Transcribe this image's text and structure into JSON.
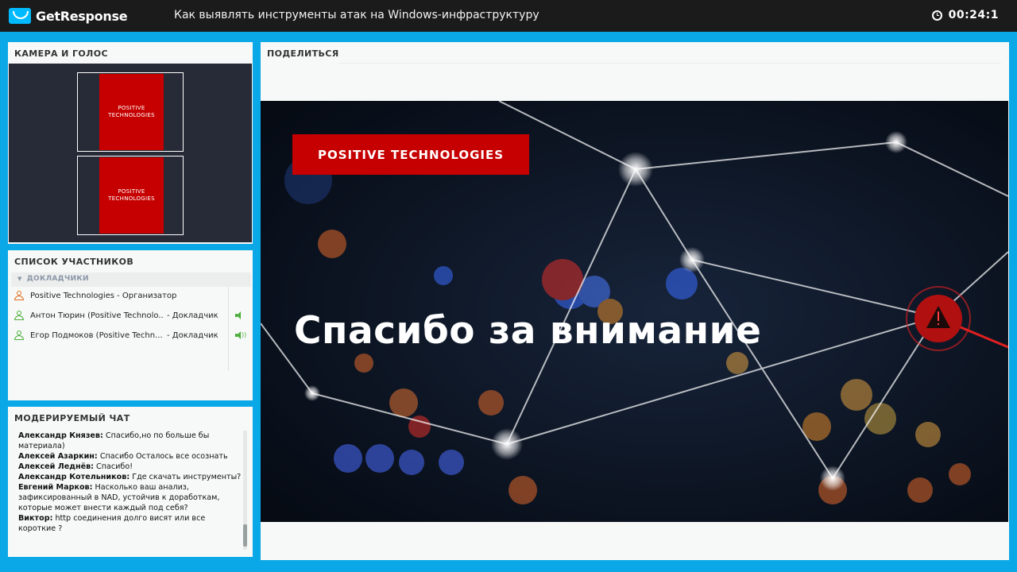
{
  "topbar": {
    "logo": "GetResponse",
    "title": "Как выявлять инструменты атак на Windows-инфраструктуру",
    "timer": "00:24:1"
  },
  "camera": {
    "header": "КАМЕРА И ГОЛОС",
    "tiles": [
      {
        "line1": "POSITIVE",
        "line2": "TECHNOLOGIES"
      },
      {
        "line1": "POSITIVE",
        "line2": "TECHNOLOGIES"
      }
    ]
  },
  "participants": {
    "header": "СПИСОК УЧАСТНИКОВ",
    "group": "ДОКЛАДЧИКИ",
    "items": [
      {
        "name": "Positive Technologies - Организатор",
        "role": ""
      },
      {
        "name": "Антон Тюрин (Positive Technolo...",
        "role": "- Докладчик"
      },
      {
        "name": "Егор Подмоков (Positive Techn...",
        "role": "- Докладчик"
      }
    ]
  },
  "chat": {
    "header": "МОДЕРИРУЕМЫЙ ЧАТ",
    "messages": [
      {
        "author": "Александр Князев:",
        "text": " Спасибо,но по больше бы материала)"
      },
      {
        "author": "Алексей Азаркин:",
        "text": " Спасибо Осталось все осознать"
      },
      {
        "author": "Алексей Леднёв:",
        "text": " Спасибо!"
      },
      {
        "author": "Александр Котельников:",
        "text": " Где скачать инструменты?"
      },
      {
        "author": "Евгений Марков:",
        "text": " Насколько ваш анализ, зафиксированный в NAD, устойчив к доработкам, которые может внести каждый под себя?"
      },
      {
        "author": "Виктор:",
        "text": " http соединения долго висят или все короткие ?"
      }
    ]
  },
  "share": {
    "header": "ПОДЕЛИТЬСЯ",
    "slide": {
      "brand": "POSITIVE TECHNOLOGIES",
      "title": "Спасибо за внимание"
    }
  },
  "colors": {
    "frame": "#0aa8e6",
    "topbar": "#1b1b1b",
    "brand_red": "#c60000",
    "speaker_green": "#4cae3c",
    "organizer_orange": "#e07020"
  }
}
